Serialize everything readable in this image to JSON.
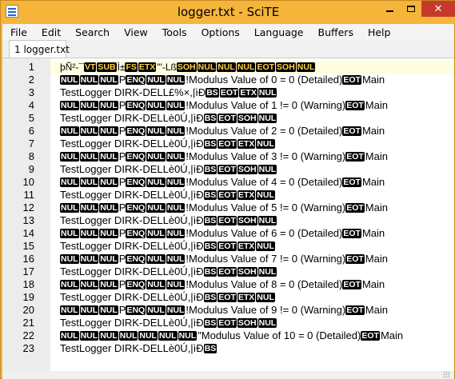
{
  "window": {
    "title": "logger.txt - SciTE",
    "minimize_glyph": "—",
    "close_glyph": "✕"
  },
  "menu": [
    "File",
    "Edit",
    "Search",
    "View",
    "Tools",
    "Options",
    "Language",
    "Buffers",
    "Help"
  ],
  "tabs": [
    {
      "label": "1 logger.txt"
    }
  ],
  "editor": {
    "line_numbers": [
      "1",
      "2",
      "3",
      "4",
      "5",
      "6",
      "7",
      "8",
      "9",
      "10",
      "11",
      "12",
      "13",
      "14",
      "15",
      "16",
      "17",
      "18",
      "19",
      "20",
      "21",
      "22",
      "23"
    ],
    "lines": [
      [
        "þÑ²-¯",
        "[VT]",
        "[SUB]",
        "Ì±",
        "[FS]",
        "[ETX]",
        "'\"-Lß",
        "[SOH]",
        "[NUL]",
        "[NUL]",
        "[NUL]",
        "[EOT]",
        "[SOH]",
        "[NUL]"
      ],
      [
        "[NUL]",
        "[NUL]",
        "[NUL]",
        "P",
        "[ENQ]",
        "[NUL]",
        "[NUL]",
        "!Modulus Value of 0 = 0 (Detailed)",
        "[EOT]",
        "Main"
      ],
      [
        "TestLogger DIRK-DELL£%×,|ìÐ",
        "[BS]",
        "[EOT]",
        "[ETX]",
        "[NUL]"
      ],
      [
        "[NUL]",
        "[NUL]",
        "[NUL]",
        "P",
        "[ENQ]",
        "[NUL]",
        "[NUL]",
        "!Modulus Value of 1 != 0 (Warning)",
        "[EOT]",
        "Main"
      ],
      [
        "TestLogger DIRK-DELLè0Ú,|ìÐ",
        "[BS]",
        "[EOT]",
        "[SOH]",
        "[NUL]"
      ],
      [
        "[NUL]",
        "[NUL]",
        "[NUL]",
        "P",
        "[ENQ]",
        "[NUL]",
        "[NUL]",
        "!Modulus Value of 2 = 0 (Detailed)",
        "[EOT]",
        "Main"
      ],
      [
        "TestLogger DIRK-DELLè0Ú,|ìÐ",
        "[BS]",
        "[EOT]",
        "[ETX]",
        "[NUL]"
      ],
      [
        "[NUL]",
        "[NUL]",
        "[NUL]",
        "P",
        "[ENQ]",
        "[NUL]",
        "[NUL]",
        "!Modulus Value of 3 != 0 (Warning)",
        "[EOT]",
        "Main"
      ],
      [
        "TestLogger DIRK-DELLè0Ú,|ìÐ",
        "[BS]",
        "[EOT]",
        "[SOH]",
        "[NUL]"
      ],
      [
        "[NUL]",
        "[NUL]",
        "[NUL]",
        "P",
        "[ENQ]",
        "[NUL]",
        "[NUL]",
        "!Modulus Value of 4 = 0 (Detailed)",
        "[EOT]",
        "Main"
      ],
      [
        "TestLogger DIRK-DELLè0Ú,|ìÐ",
        "[BS]",
        "[EOT]",
        "[ETX]",
        "[NUL]"
      ],
      [
        "[NUL]",
        "[NUL]",
        "[NUL]",
        "P",
        "[ENQ]",
        "[NUL]",
        "[NUL]",
        "!Modulus Value of 5 != 0 (Warning)",
        "[EOT]",
        "Main"
      ],
      [
        "TestLogger DIRK-DELLè0Ú,|ìÐ",
        "[BS]",
        "[EOT]",
        "[SOH]",
        "[NUL]"
      ],
      [
        "[NUL]",
        "[NUL]",
        "[NUL]",
        "P",
        "[ENQ]",
        "[NUL]",
        "[NUL]",
        "!Modulus Value of 6 = 0 (Detailed)",
        "[EOT]",
        "Main"
      ],
      [
        "TestLogger DIRK-DELLè0Ú,|ìÐ",
        "[BS]",
        "[EOT]",
        "[ETX]",
        "[NUL]"
      ],
      [
        "[NUL]",
        "[NUL]",
        "[NUL]",
        "P",
        "[ENQ]",
        "[NUL]",
        "[NUL]",
        "!Modulus Value of 7 != 0 (Warning)",
        "[EOT]",
        "Main"
      ],
      [
        "TestLogger DIRK-DELLè0Ú,|ìÐ",
        "[BS]",
        "[EOT]",
        "[SOH]",
        "[NUL]"
      ],
      [
        "[NUL]",
        "[NUL]",
        "[NUL]",
        "P",
        "[ENQ]",
        "[NUL]",
        "[NUL]",
        "!Modulus Value of 8 = 0 (Detailed)",
        "[EOT]",
        "Main"
      ],
      [
        "TestLogger DIRK-DELLè0Ú,|ìÐ",
        "[BS]",
        "[EOT]",
        "[ETX]",
        "[NUL]"
      ],
      [
        "[NUL]",
        "[NUL]",
        "[NUL]",
        "P",
        "[ENQ]",
        "[NUL]",
        "[NUL]",
        "!Modulus Value of 9 != 0 (Warning)",
        "[EOT]",
        "Main"
      ],
      [
        "TestLogger DIRK-DELLè0Ú,|ìÐ",
        "[BS]",
        "[EOT]",
        "[SOH]",
        "[NUL]"
      ],
      [
        "[NUL]",
        "[NUL]",
        "[NUL]",
        "[NUL]",
        "[NUL]",
        "[NUL]",
        "[NUL]",
        "\"Modulus Value of 10 = 0 (Detailed)",
        "[EOT]",
        "Main"
      ],
      [
        "TestLogger DIRK-DELLè0Ú,|ìÐ",
        "[BS]"
      ]
    ]
  },
  "colors": {
    "title_bar": "#f5b53a",
    "close_button": "#c7392a",
    "caret_line": "#fffde0",
    "control_char_bg": "#000000"
  }
}
